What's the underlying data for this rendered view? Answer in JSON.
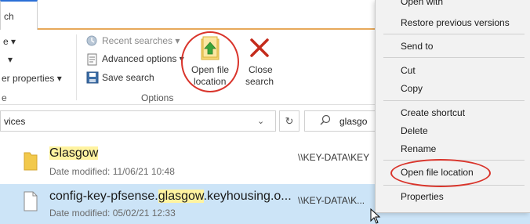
{
  "tabs": {
    "search_tab": "ch"
  },
  "ribbon": {
    "left_clip_1": "e ▾",
    "left_clip_2": "▾",
    "left_clip_3": "er properties ▾",
    "left_clip_4": "e",
    "recent_searches": "Recent searches ▾",
    "advanced_options": "Advanced options ▾",
    "save_search": "Save search",
    "open_file_location_line1": "Open file",
    "open_file_location_line2": "location",
    "close_search_line1": "Close",
    "close_search_line2": "search",
    "options_group": "Options"
  },
  "address": {
    "path": "vices",
    "search_query": "glasgo"
  },
  "files": [
    {
      "name": "Glasgow",
      "meta": "Date modified: 11/06/21 10:48",
      "path": "\\\\KEY-DATA\\KEY"
    },
    {
      "name_pre": "config-key-pfsense.",
      "name_hl": "glasgow",
      "name_post": ".keyhousing.o...",
      "meta": "Date modified: 05/02/21 12:33",
      "path": "\\\\KEY-DATA\\K..."
    }
  ],
  "context_menu": {
    "open_with": "Open with",
    "restore_previous_versions": "Restore previous versions",
    "send_to": "Send to",
    "cut": "Cut",
    "copy": "Copy",
    "create_shortcut": "Create shortcut",
    "delete": "Delete",
    "rename": "Rename",
    "open_file_location": "Open file location",
    "properties": "Properties"
  },
  "colors": {
    "selection": "#cce4f7",
    "highlight": "#fff3a0",
    "annotation": "#d9342b",
    "close_x": "#c42b1c",
    "folder": "#f2c94c"
  }
}
